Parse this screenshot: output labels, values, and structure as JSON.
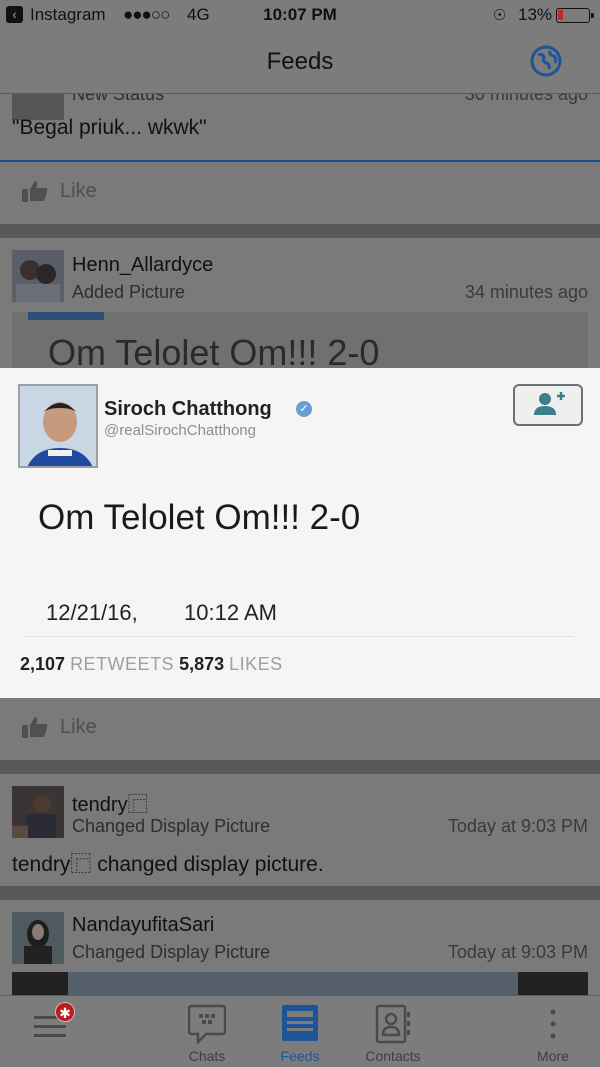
{
  "status_bar": {
    "back_app": "Instagram",
    "signal": "●●●○○",
    "network": "4G",
    "time": "10:07 PM",
    "battery": "13%"
  },
  "header": {
    "title": "Feeds",
    "globe_icon": "globe-icon",
    "accent": "#1d5596"
  },
  "feed": {
    "post1": {
      "title": "New Status",
      "time": "30 minutes ago",
      "text": "\"Begal priuk... wkwk\"",
      "like_label": "Like"
    },
    "post2": {
      "name": "Henn_Allardyce",
      "action": "Added Picture",
      "time": "34 minutes ago",
      "image_text": "Om Telolet Om!!! 2-0",
      "like_label": "Like"
    },
    "post3": {
      "name": "tendry⿸",
      "action": "Changed Display Picture",
      "time": "Today at 9:03 PM",
      "text": "tendry⿸ changed display picture."
    },
    "post4": {
      "name": "NandayufitaSari",
      "action": "Changed Display Picture",
      "time": "Today at 9:03 PM"
    }
  },
  "overlay": {
    "name": "Siroch Chatthong",
    "handle": "@realSirochChatthong",
    "text": "Om Telolet Om!!! 2-0",
    "date": "12/21/16,",
    "time": "10:12 AM",
    "retweets": "2,107",
    "retweets_label": "RETWEETS",
    "likes": "5,873",
    "likes_label": "LIKES"
  },
  "tabbar": {
    "tabs": [
      {
        "label": "",
        "icon": "menu-icon",
        "badge": "✱"
      },
      {
        "label": "Chats",
        "icon": "chat-bubble-icon"
      },
      {
        "label": "Feeds",
        "icon": "feeds-icon",
        "active": true
      },
      {
        "label": "Contacts",
        "icon": "contacts-icon"
      },
      {
        "label": "More",
        "icon": "more-dots-icon"
      }
    ]
  }
}
